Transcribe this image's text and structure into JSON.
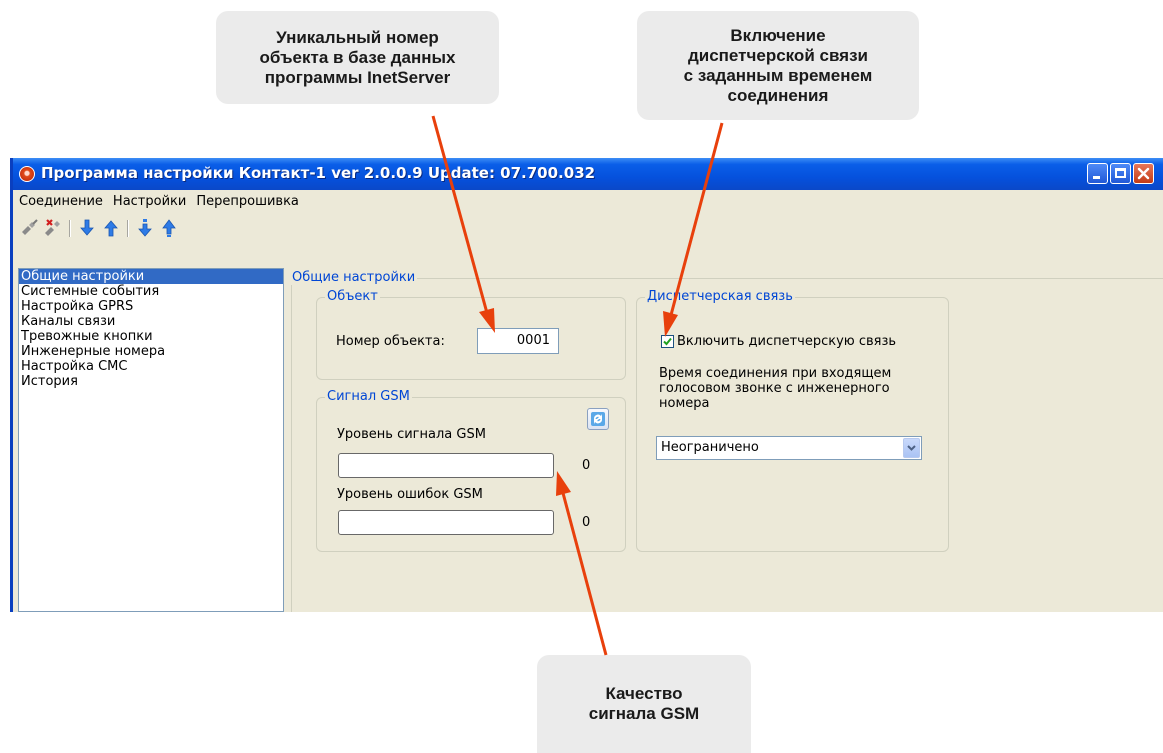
{
  "callouts": {
    "object_number": "Уникальный номер\nобъекта в базе данных\nпрограммы InetServer",
    "dispatch": "Включение\nдиспетчерской связи\nс заданным временем\nсоединения",
    "gsm": "Качество\nсигнала GSM"
  },
  "window": {
    "title": "Программа настройки Контакт-1 ver 2.0.0.9 Update: 07.700.032"
  },
  "menu": {
    "items": [
      "Соединение",
      "Настройки",
      "Перепрошивка"
    ]
  },
  "toolbar": {
    "icons": [
      "connect-icon",
      "disconnect-icon",
      "download-icon",
      "upload-icon",
      "download-file-icon",
      "upload-file-icon"
    ]
  },
  "tree": {
    "items": [
      "Общие настройки",
      "Системные события",
      "Настройка GPRS",
      "Каналы связи",
      "Тревожные кнопки",
      "Инженерные номера",
      "Настройка СМС",
      "История"
    ],
    "selected_index": 0
  },
  "general": {
    "title": "Общие настройки",
    "object": {
      "title": "Объект",
      "number_label": "Номер объекта:",
      "number_value": "0001"
    },
    "gsm": {
      "title": "Сигнал GSM",
      "signal_label": "Уровень сигнала GSM",
      "signal_value": "0",
      "errors_label": "Уровень ошибок GSM",
      "errors_value": "0",
      "signal_level": 0,
      "errors_level": 0
    },
    "dispatch": {
      "title": "Диспетчерская связь",
      "enable_label": "Включить диспетчерскую связь",
      "enabled": true,
      "time_label": "Время соединения при входящем голосовом звонке с инженерного номера",
      "time_value": "Неограничено"
    }
  },
  "colors": {
    "arrow": "#e8400c",
    "selection": "#316ac5",
    "group_title": "#0046d5"
  }
}
